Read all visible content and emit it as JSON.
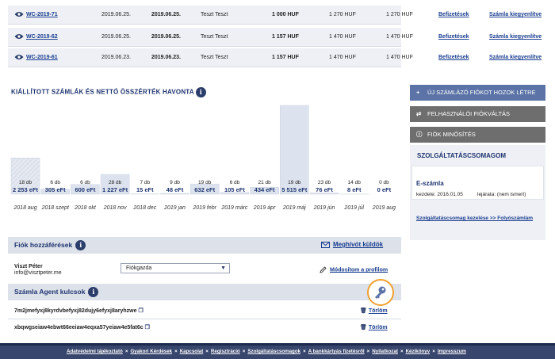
{
  "invoices": [
    {
      "number": "WC-2019-71",
      "issue_date": "2019.06.25.",
      "due_date": "2019.06.25.",
      "customer": "Teszt Teszt",
      "net": "1 000 HUF",
      "gross": "1 270 HUF",
      "gross2": "1 270 HUF",
      "paid": "Befizetések",
      "pay": "Számla kiegyenlítve"
    },
    {
      "number": "WC-2019-62",
      "issue_date": "2019.06.25.",
      "due_date": "2019.06.25.",
      "customer": "Teszt Teszt",
      "net": "1 157 HUF",
      "gross": "1 470 HUF",
      "gross2": "1 470 HUF",
      "paid": "Befizetések",
      "pay": "Számla kiegyenlítve"
    },
    {
      "number": "WC-2019-61",
      "issue_date": "2019.06.23.",
      "due_date": "2019.06.23.",
      "customer": "Teszt Teszt",
      "net": "1 157 HUF",
      "gross": "1 470 HUF",
      "gross2": "1 470 HUF",
      "paid": "Befizetések",
      "pay": "Számla kiegyenlítve"
    }
  ],
  "chart_title": "KIÁLLÍTOTT SZÁMLÁK ÉS NETTÓ ÖSSZÉRTÉK HAVONTA",
  "chart_data": {
    "type": "bar",
    "title": "KIÁLLÍTOTT SZÁMLÁK ÉS NETTÓ ÖSSZÉRTÉK HAVONTA",
    "categories": [
      "2018 aug",
      "2018 szept",
      "2018 okt",
      "2018 nov",
      "2018 dec",
      "2019 jan",
      "2019 febr",
      "2019 márc",
      "2019 ápr",
      "2019 máj",
      "2019 jún",
      "2019 júl",
      "2019 aug"
    ],
    "series": [
      {
        "values": [
          2253,
          305,
          600,
          1227,
          15,
          48,
          632,
          105,
          434,
          5515,
          76,
          8,
          0
        ]
      }
    ],
    "counts": [
      "18 db",
      "6 db",
      "6 db",
      "28 db",
      "7 db",
      "9 db",
      "19 db",
      "6 db",
      "21 db",
      "19 db",
      "23 db",
      "14 db",
      "0 db"
    ],
    "value_labels": [
      "2 253 eFt",
      "305 eFt",
      "600 eFt",
      "1 227 eFt",
      "15 eFt",
      "48 eFt",
      "632 eFt",
      "105 eFt",
      "434 eFt",
      "5 515 eFt",
      "76 eFt",
      "8 eFt",
      "0 eFt"
    ],
    "ylim": [
      0,
      5515
    ],
    "colors": {
      "bar": "#dde3ee",
      "bar_outline": "#c9d1e0"
    }
  },
  "side": {
    "btn_new": "ÚJ SZÁMLÁZÓ FIÓKOT HOZOK LÉTRE",
    "btn_switch": "FELHASZNÁLÓI FIÓKVÁLTÁS",
    "btn_rating": "FIÓK MINŐSÍTÉS",
    "pkg_title": "SZOLGÁLTATÁSCSOMAGOM",
    "pkg_name": "E-számla",
    "pkg_start": "kezdete: 2016.01.05",
    "pkg_expiry": "lejárata: (nem ismert)",
    "pkg_link": "Szolgáltatáscsomag kezelése >> Folyószámlám",
    "colors": {
      "new": "#5b73a6",
      "switch": "#6e6e6e",
      "rating": "#6e6e6e"
    }
  },
  "access": {
    "title": "Fiók hozzáférések",
    "invite": "Meghívót küldök",
    "user_name": "Viszt Péter",
    "user_email": "info@visztpeter.me",
    "role": "Fiókgazda",
    "modify": "Módosítom a profilom"
  },
  "agent": {
    "title": "Számla Agent kulcsok",
    "keys": [
      "7m2jmefyxj8kyrdvbefyxj82dujy6efyxj8aryhzwe",
      "xbqwgseiaw4ebwt66eeiaw4eqxa57yeiaw4e5fat6c"
    ],
    "delete": "Törlöm"
  },
  "footer": [
    "Adatvédelmi tájékoztató",
    "Gyakori Kérdések",
    "Kapcsolat",
    "Regisztráció",
    "Szolgáltatáscsomagok",
    "A bankkártyás fizetésről",
    "Nyilatkozat",
    "Kézikönyv",
    "Impresszum"
  ]
}
